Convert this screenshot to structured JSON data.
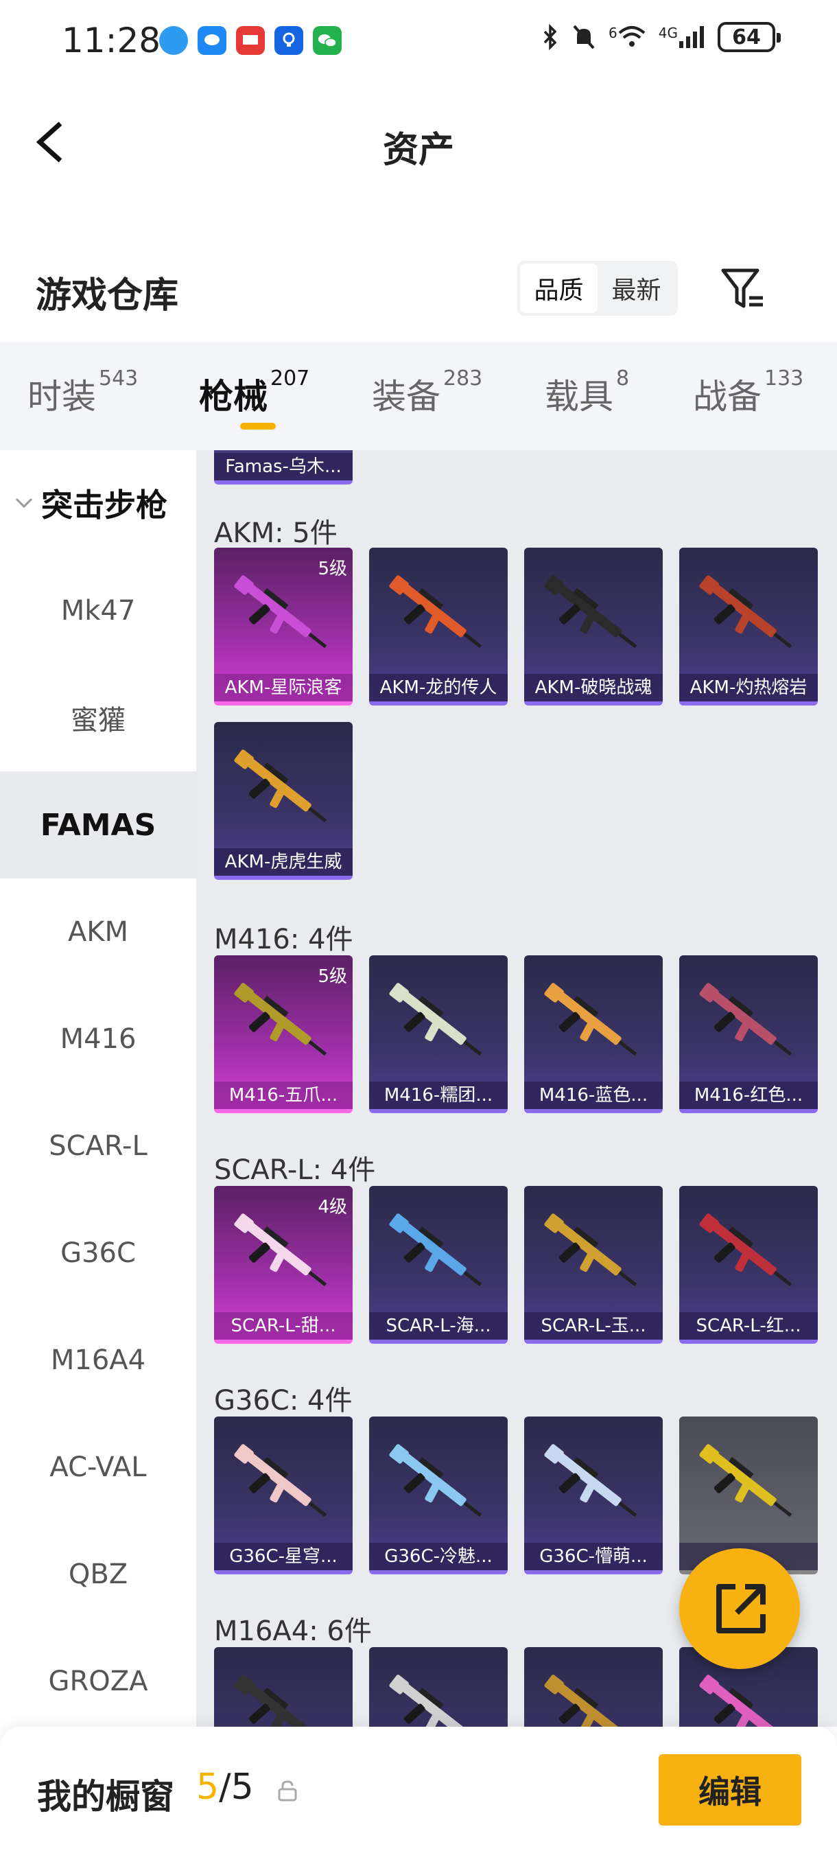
{
  "status_bar": {
    "time": "11:28",
    "signal_label": "4G",
    "wifi_label": "6",
    "battery": "64"
  },
  "header": {
    "title": "资产"
  },
  "section": {
    "title": "游戏仓库"
  },
  "sort": {
    "options": [
      "品质",
      "最新"
    ],
    "active": "品质"
  },
  "tabs": [
    {
      "label": "时装",
      "count": "543"
    },
    {
      "label": "枪械",
      "count": "207",
      "active": true
    },
    {
      "label": "装备",
      "count": "283"
    },
    {
      "label": "载具",
      "count": "8"
    },
    {
      "label": "战备",
      "count": "133"
    }
  ],
  "sidebar": {
    "group": "突击步枪",
    "items": [
      "Mk47",
      "蜜獾",
      "FAMAS",
      "AKM",
      "M416",
      "SCAR-L",
      "G36C",
      "M16A4",
      "AC-VAL",
      "QBZ",
      "GROZA"
    ],
    "active": "FAMAS"
  },
  "content": {
    "top_partial_card": "Famas-乌木...",
    "groups": [
      {
        "header": "AKM: 5件",
        "items": [
          {
            "label": "AKM-星际浪客",
            "level": "5级",
            "tier": "pink",
            "color": "#c84fd6"
          },
          {
            "label": "AKM-龙的传人",
            "tier": "purple",
            "color": "#e05a2a"
          },
          {
            "label": "AKM-破晓战魂",
            "tier": "purple",
            "color": "#2b2b2b"
          },
          {
            "label": "AKM-灼热熔岩",
            "tier": "purple",
            "color": "#b8432a"
          },
          {
            "label": "AKM-虎虎生威",
            "tier": "purple",
            "color": "#e0a030"
          }
        ]
      },
      {
        "header": "M416: 4件",
        "items": [
          {
            "label": "M416-五爪...",
            "level": "5级",
            "tier": "pink",
            "color": "#b09a2a"
          },
          {
            "label": "M416-糯团...",
            "tier": "purple",
            "color": "#d9e0c8"
          },
          {
            "label": "M416-蓝色...",
            "tier": "purple",
            "color": "#e8a040"
          },
          {
            "label": "M416-红色...",
            "tier": "purple",
            "color": "#b8506a"
          }
        ]
      },
      {
        "header": "SCAR-L: 4件",
        "items": [
          {
            "label": "SCAR-L-甜...",
            "level": "4级",
            "tier": "pink",
            "color": "#f4d7ea"
          },
          {
            "label": "SCAR-L-海...",
            "tier": "purple",
            "color": "#5aa8e8"
          },
          {
            "label": "SCAR-L-玉...",
            "tier": "purple",
            "color": "#d0a030"
          },
          {
            "label": "SCAR-L-红...",
            "tier": "purple",
            "color": "#c0303a"
          }
        ]
      },
      {
        "header": "G36C: 4件",
        "items": [
          {
            "label": "G36C-星穹...",
            "tier": "purple",
            "color": "#f0c8c8"
          },
          {
            "label": "G36C-冷魅...",
            "tier": "purple",
            "color": "#8ac8f0"
          },
          {
            "label": "G36C-懵萌...",
            "tier": "purple",
            "color": "#c8d8f0"
          },
          {
            "label": "",
            "tier": "grey",
            "color": "#e0c020"
          }
        ]
      },
      {
        "header": "M16A4: 6件",
        "items": [
          {
            "label": "",
            "tier": "purple",
            "color": "#333333"
          },
          {
            "label": "",
            "tier": "purple",
            "color": "#d0d0d0"
          },
          {
            "label": "",
            "tier": "purple",
            "color": "#c09030"
          },
          {
            "label": "",
            "tier": "purple",
            "color": "#e060c0"
          }
        ]
      }
    ]
  },
  "bottom": {
    "label": "我的橱窗",
    "current": "5",
    "total": "5",
    "separator": "/",
    "edit": "编辑"
  },
  "colors": {
    "accent": "#f7b211",
    "pink_tier": "#d53fd4",
    "purple_tier": "#8b6cf0"
  }
}
